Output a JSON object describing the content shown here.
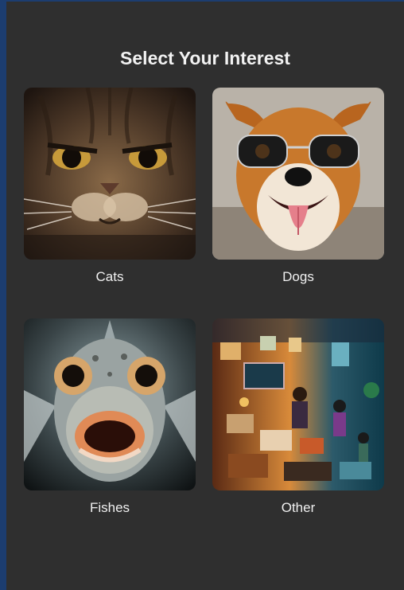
{
  "page": {
    "title": "Select Your Interest"
  },
  "interests": [
    {
      "label": "Cats",
      "icon": "cat-photo"
    },
    {
      "label": "Dogs",
      "icon": "dog-photo"
    },
    {
      "label": "Fishes",
      "icon": "fish-photo"
    },
    {
      "label": "Other",
      "icon": "hobbies-collage-photo"
    }
  ],
  "colors": {
    "background": "#2f2f2f",
    "border_accent": "#1c3d70",
    "text": "#f2f2f2"
  }
}
